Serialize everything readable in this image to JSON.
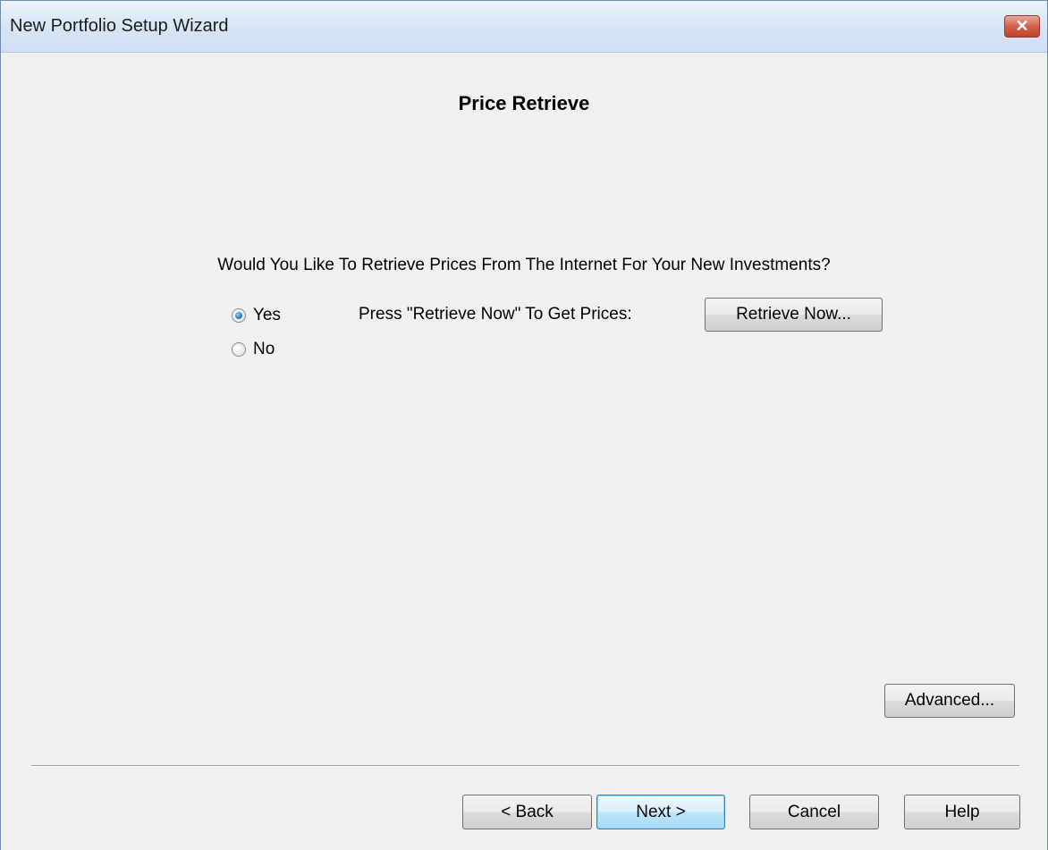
{
  "window": {
    "title": "New Portfolio Setup Wizard",
    "close_glyph": "✕"
  },
  "page": {
    "heading": "Price Retrieve",
    "question": "Would You Like To Retrieve Prices From The Internet For Your New Investments?"
  },
  "options": {
    "yes_label": "Yes",
    "no_label": "No",
    "selected": "Yes"
  },
  "retrieve": {
    "instruction": "Press \"Retrieve Now\" To Get Prices:",
    "button_label": "Retrieve Now..."
  },
  "advanced": {
    "button_label": "Advanced..."
  },
  "footer": {
    "back_label": "< Back",
    "next_label": "Next >",
    "cancel_label": "Cancel",
    "help_label": "Help"
  },
  "colors": {
    "titlebar": "#d6e5f5",
    "close_button": "#d4604b",
    "dialog_background": "#f0f0f0",
    "default_button_border": "#3c7fb1"
  }
}
